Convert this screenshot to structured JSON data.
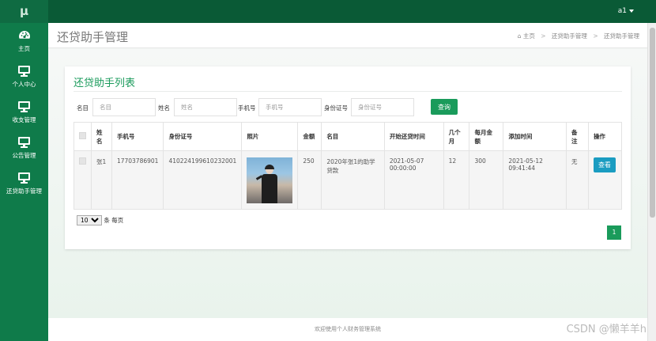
{
  "app": {
    "logo": "μ",
    "user": "a1"
  },
  "sidebar": {
    "items": [
      {
        "label": "主页",
        "icon": "dashboard-icon"
      },
      {
        "label": "个人中心",
        "icon": "monitor-icon"
      },
      {
        "label": "收支管理",
        "icon": "monitor-icon"
      },
      {
        "label": "公告管理",
        "icon": "monitor-icon"
      },
      {
        "label": "还贷助手管理",
        "icon": "monitor-icon"
      }
    ]
  },
  "header": {
    "title": "还贷助手管理",
    "breadcrumb": [
      "主页",
      "还贷助手管理",
      "还贷助手管理"
    ]
  },
  "card": {
    "title": "还贷助手列表"
  },
  "filters": [
    {
      "label": "名目",
      "placeholder": "名目"
    },
    {
      "label": "姓名",
      "placeholder": "姓名"
    },
    {
      "label": "手机号",
      "placeholder": "手机号"
    },
    {
      "label": "身份证号",
      "placeholder": "身份证号"
    }
  ],
  "query_button": "查询",
  "table": {
    "headers": [
      "姓名",
      "手机号",
      "身份证号",
      "照片",
      "金额",
      "名目",
      "开始还贷时间",
      "几个月",
      "每月金额",
      "添加时间",
      "备注",
      "操作"
    ],
    "rows": [
      {
        "name": "张1",
        "phone": "17703786901",
        "id_number": "410224199610232001",
        "amount": "250",
        "item": "2020年张1的助学贷款",
        "start_time": "2021-05-07 00:00:00",
        "months": "12",
        "monthly_amount": "300",
        "add_time": "2021-05-12 09:41:44",
        "remark": "无",
        "action": "查看"
      }
    ]
  },
  "pager": {
    "page_size": "10",
    "per_page_text": "条 每页",
    "current_page": "1"
  },
  "footer": {
    "text": "欢迎使用个人财务管理系统"
  },
  "watermark": "CSDN @懒羊羊h",
  "colors": {
    "primary": "#1a9b5b",
    "sidebar": "#0f7b4a",
    "topbar": "#0a5a36",
    "view_button": "#1a9cc1"
  }
}
